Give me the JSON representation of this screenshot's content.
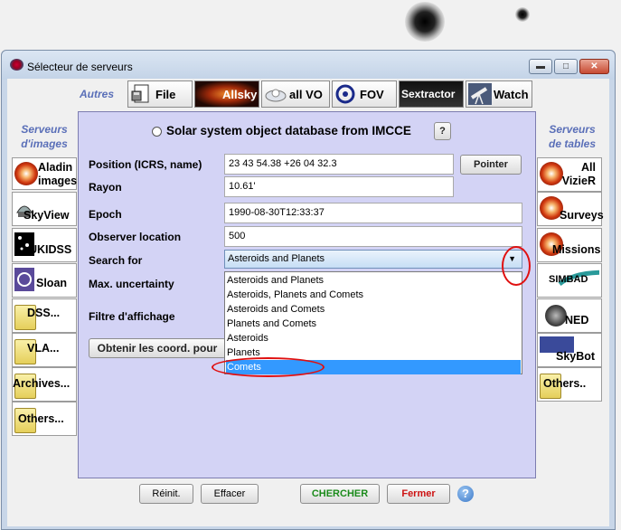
{
  "window": {
    "title": "Sélecteur de serveurs",
    "minimize_symbol": "▬",
    "maximize_symbol": "□",
    "close_symbol": "✕"
  },
  "sections": {
    "autres": "Autres",
    "serveurs_images": [
      "Serveurs",
      "d'images"
    ],
    "serveurs_tables": [
      "Serveurs",
      "de tables"
    ]
  },
  "top_tabs": [
    {
      "label": "File",
      "icon": "file-icon"
    },
    {
      "label": "Allsky",
      "icon": "allsky-icon"
    },
    {
      "label": "all VO",
      "icon": "vo-icon"
    },
    {
      "label": "FOV",
      "icon": "fov-icon"
    },
    {
      "label": "Sextractor",
      "icon": "sextractor-icon"
    },
    {
      "label": "Watch",
      "icon": "telescope-icon"
    }
  ],
  "left_tiles": [
    {
      "label": "Aladin",
      "label2": "images",
      "icon": "aladin-icon"
    },
    {
      "label": "SkyView",
      "icon": "skyview-icon"
    },
    {
      "label": "UKIDSS",
      "icon": "ukidss-icon"
    },
    {
      "label": "Sloan",
      "icon": "sloan-icon"
    },
    {
      "label": "DSS...",
      "icon": "folder-icon"
    },
    {
      "label": "VLA...",
      "icon": "folder-icon"
    },
    {
      "label": "Archives...",
      "icon": "folder-icon"
    },
    {
      "label": "Others...",
      "icon": "folder-icon"
    }
  ],
  "right_tiles": [
    {
      "label": "All",
      "label2": "VizieR",
      "icon": "vizier-icon"
    },
    {
      "label": "Surveys",
      "icon": "surveys-icon"
    },
    {
      "label": "Missions",
      "icon": "missions-icon"
    },
    {
      "label": "SIMBAD",
      "icon": "simbad-icon"
    },
    {
      "label": "NED",
      "icon": "ned-icon"
    },
    {
      "label": "SkyBot",
      "icon": "skybot-icon"
    },
    {
      "label": "Others..",
      "icon": "folder-icon"
    }
  ],
  "form": {
    "heading": "Solar system object database from IMCCE",
    "help_button": "?",
    "position_label": "Position (ICRS, name)",
    "position_value": "23 43 54.38 +26 04 32.3",
    "pointer_button": "Pointer",
    "rayon_label": "Rayon",
    "rayon_value": "10.61'",
    "epoch_label": "Epoch",
    "epoch_value": "1990-08-30T12:33:37",
    "observer_label": "Observer location",
    "observer_value": "500",
    "search_label": "Search for",
    "search_selected": "Asteroids and Planets",
    "search_options": [
      "Asteroids and Planets",
      "Asteroids, Planets and Comets",
      "Asteroids and Comets",
      "Planets and Comets",
      "Asteroids",
      "Planets",
      "Comets"
    ],
    "highlighted_option": "Comets",
    "uncertainty_label": "Max. uncertainty",
    "filter_label": "Filtre d'affichage",
    "coords_button": "Obtenir les coord. pour"
  },
  "bottom_buttons": {
    "reinit": "Réinit.",
    "effacer": "Effacer",
    "chercher": "CHERCHER",
    "fermer": "Fermer",
    "help": "?"
  },
  "colors": {
    "panel_bg": "#d3d3f5",
    "selection": "#3399ff",
    "annotation_red": "#e01010",
    "chercher_green": "#1a8a1a",
    "fermer_red": "#cc1111",
    "section_blue": "#5a6fb8"
  }
}
